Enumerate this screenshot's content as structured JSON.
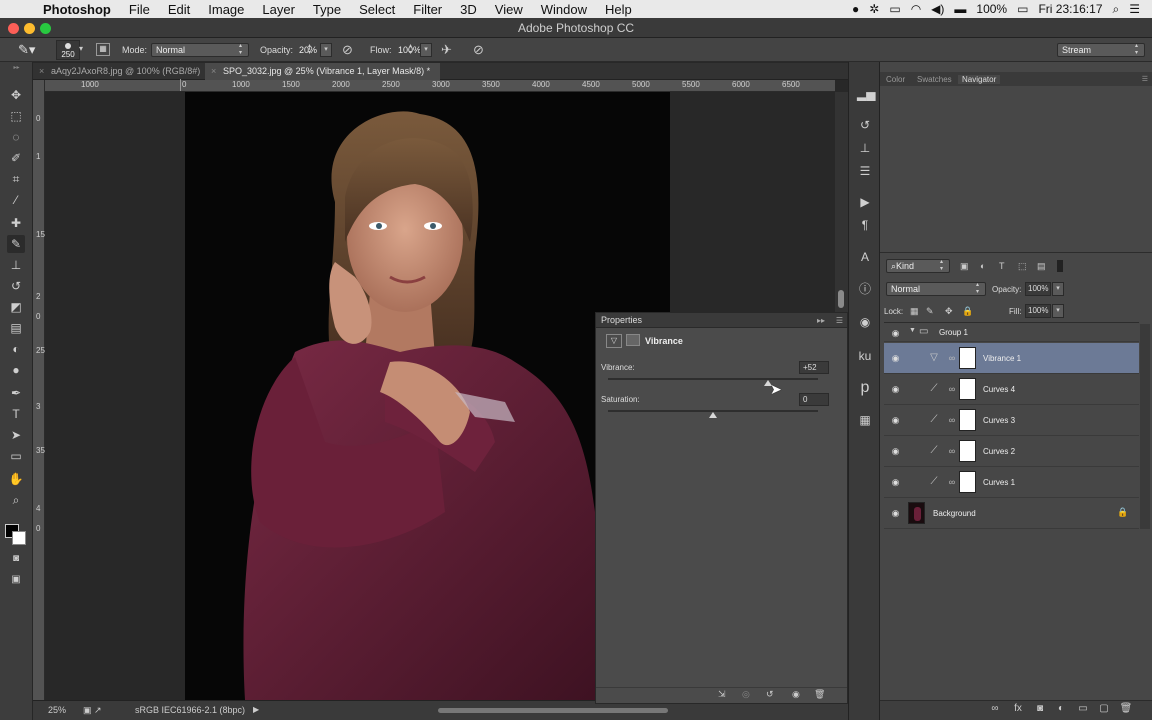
{
  "menubar": {
    "app_name": "Photoshop",
    "menus": [
      "File",
      "Edit",
      "Image",
      "Layer",
      "Type",
      "Select",
      "Filter",
      "3D",
      "View",
      "Window",
      "Help"
    ],
    "battery": "100%",
    "clock": "Fri 23:16:17"
  },
  "window": {
    "title": "Adobe Photoshop CC"
  },
  "options": {
    "brush_size": "250",
    "mode_label": "Mode:",
    "mode_value": "Normal",
    "opacity_label": "Opacity:",
    "opacity_value": "20%",
    "flow_label": "Flow:",
    "flow_value": "100%",
    "workspace": "Stream"
  },
  "tabs": [
    {
      "label": "aAqy2JAxoR8.jpg @ 100% (RGB/8#)"
    },
    {
      "label": "SPO_3032.jpg @ 25% (Vibrance 1, Layer Mask/8) *"
    }
  ],
  "ruler": {
    "h_labels": [
      "1000",
      "0",
      "1000",
      "1500",
      "2000",
      "2500",
      "3000",
      "3500",
      "4000",
      "4500",
      "5000",
      "5500",
      "6000",
      "6500"
    ],
    "v_labels": [
      "0",
      "1",
      "1500",
      "2",
      "0",
      "2500",
      "3",
      "3500",
      "4",
      "0"
    ]
  },
  "status": {
    "zoom": "25%",
    "profile": "sRGB IEC61966-2.1 (8bpc)"
  },
  "properties": {
    "title": "Properties",
    "adjustment": "Vibrance",
    "vibrance_label": "Vibrance:",
    "vibrance_value": "+52",
    "vibrance_level": 0.76,
    "saturation_label": "Saturation:",
    "saturation_value": "0",
    "saturation_level": 0.5
  },
  "panels": {
    "top_tabs": [
      "Color",
      "Swatches",
      "Navigator"
    ],
    "filter_kind": "Kind",
    "blend_mode": "Normal",
    "opacity_label": "Opacity:",
    "opacity_value": "100%",
    "lock_label": "Lock:",
    "fill_label": "Fill:",
    "fill_value": "100%"
  },
  "layers": [
    {
      "name": "Group 1",
      "type": "group"
    },
    {
      "name": "Vibrance 1",
      "type": "vibrance",
      "selected": true
    },
    {
      "name": "Curves 4",
      "type": "curves"
    },
    {
      "name": "Curves 3",
      "type": "curves"
    },
    {
      "name": "Curves 2",
      "type": "curves"
    },
    {
      "name": "Curves 1",
      "type": "curves"
    },
    {
      "name": "Background",
      "type": "background"
    }
  ],
  "colors": {
    "selection": "#6c7a96",
    "sweater": "#5e1e33",
    "panel": "#474747"
  }
}
